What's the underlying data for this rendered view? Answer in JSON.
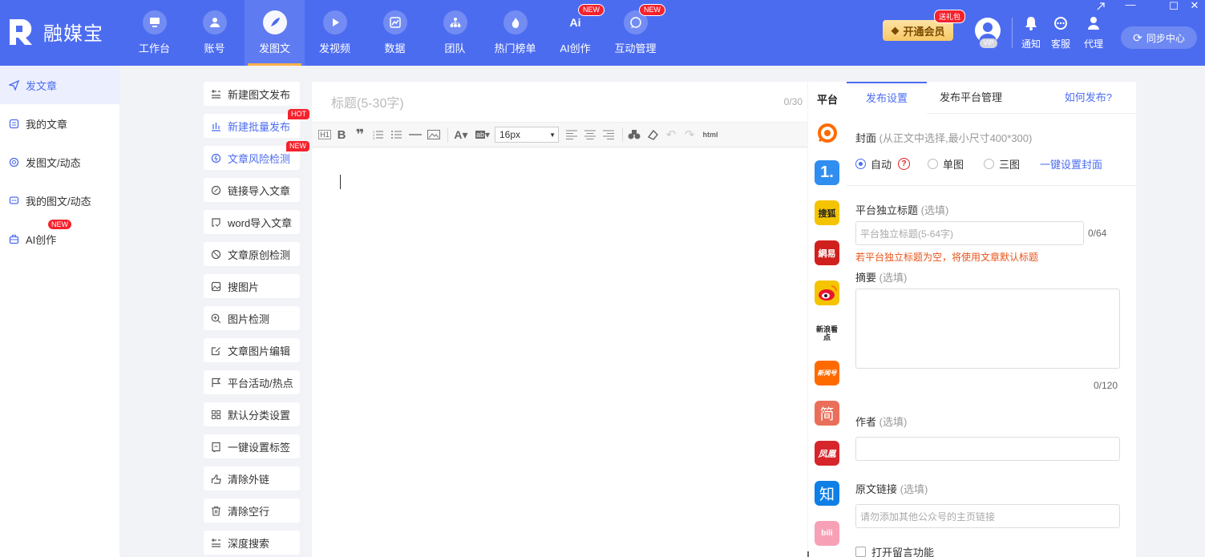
{
  "app": {
    "name": "融媒宝"
  },
  "nav": [
    {
      "label": "工作台",
      "icon": "monitor-icon"
    },
    {
      "label": "账号",
      "icon": "user-icon"
    },
    {
      "label": "发图文",
      "icon": "feather-icon",
      "active": true
    },
    {
      "label": "发视频",
      "icon": "play-icon"
    },
    {
      "label": "数据",
      "icon": "chart-icon"
    },
    {
      "label": "团队",
      "icon": "org-icon"
    },
    {
      "label": "热门榜单",
      "icon": "flame-icon"
    },
    {
      "label": "AI创作",
      "icon": "ai-icon",
      "badge": "NEW"
    },
    {
      "label": "互动管理",
      "icon": "chat-icon",
      "badge": "NEW"
    }
  ],
  "header": {
    "vip_label": "开通会员",
    "gift_badge": "送礼包",
    "vip_tag": "VIP",
    "notify_label": "通知",
    "service_label": "客服",
    "agent_label": "代理",
    "sync_label": "同步中心"
  },
  "sidebar": [
    {
      "label": "发文章",
      "icon": "send-icon",
      "active": true
    },
    {
      "label": "我的文章",
      "icon": "document-icon"
    },
    {
      "label": "发图文/动态",
      "icon": "target-icon"
    },
    {
      "label": "我的图文/动态",
      "icon": "message-icon"
    },
    {
      "label": "AI创作",
      "icon": "briefcase-icon",
      "badge": "NEW"
    }
  ],
  "tools": [
    {
      "label": "新建图文发布",
      "icon": "new-post-icon"
    },
    {
      "label": "新建批量发布",
      "icon": "batch-icon",
      "badge": "HOT",
      "highlight": true
    },
    {
      "label": "文章风险检测",
      "icon": "risk-icon",
      "badge": "NEW",
      "highlight": true
    },
    {
      "label": "链接导入文章",
      "icon": "link-icon"
    },
    {
      "label": "word导入文章",
      "icon": "word-icon"
    },
    {
      "label": "文章原创检测",
      "icon": "original-icon"
    },
    {
      "label": "搜图片",
      "icon": "image-icon"
    },
    {
      "label": "图片检测",
      "icon": "zoom-icon"
    },
    {
      "label": "文章图片编辑",
      "icon": "edit-icon"
    },
    {
      "label": "平台活动/热点",
      "icon": "flag-icon"
    },
    {
      "label": "默认分类设置",
      "icon": "grid-icon"
    },
    {
      "label": "一键设置标签",
      "icon": "tag-icon"
    },
    {
      "label": "清除外链",
      "icon": "unlink-icon"
    },
    {
      "label": "清除空行",
      "icon": "trash-icon"
    },
    {
      "label": "深度搜索",
      "icon": "search-icon"
    }
  ],
  "editor": {
    "title_placeholder": "标题(5-30字)",
    "title_count": "0/30",
    "font_size": "16px",
    "html_label": "html"
  },
  "platforms": {
    "header": "平台",
    "items": [
      {
        "name": "baijiahao",
        "glyph": "",
        "color": "#ffffff"
      },
      {
        "name": "yidian",
        "glyph": "1.",
        "color": "#2f8ef0"
      },
      {
        "name": "sohu",
        "glyph": "搜狐",
        "color": "#f5c400"
      },
      {
        "name": "netease",
        "glyph": "網易",
        "color": "#d0201e"
      },
      {
        "name": "weibo",
        "glyph": "",
        "color": "#f5c400"
      },
      {
        "name": "sina-kandian",
        "glyph": "新浪看点",
        "color": "#ffffff"
      },
      {
        "name": "xinwenquan",
        "glyph": "新闻号",
        "color": "#ff6a00"
      },
      {
        "name": "jianshu",
        "glyph": "简",
        "color": "#ea6f5a"
      },
      {
        "name": "fenghuang",
        "glyph": "凤凰",
        "color": "#d7252c"
      },
      {
        "name": "zhihu",
        "glyph": "知",
        "color": "#0e7fe6"
      },
      {
        "name": "bilibili",
        "glyph": "bili",
        "color": "#f7a0b6"
      }
    ]
  },
  "panel": {
    "tab_settings": "发布设置",
    "tab_platforms": "发布平台管理",
    "how_to": "如何发布?",
    "cover_label": "封面",
    "cover_hint": "(从正文中选择,最小尺寸400*300)",
    "radio_auto": "自动",
    "radio_single": "单图",
    "radio_triple": "三图",
    "one_click_cover": "一键设置封面",
    "title_label": "平台独立标题",
    "optional": "(选填)",
    "title_placeholder": "平台独立标题(5-64字)",
    "title_count": "0/64",
    "title_warning": "若平台独立标题为空，将使用文章默认标题",
    "summary_label": "摘要",
    "summary_count": "0/120",
    "author_label": "作者",
    "source_label": "原文链接",
    "source_placeholder": "请勿添加其他公众号的主页链接",
    "comment_label": "打开留言功能"
  },
  "colors": {
    "primary": "#4c6cf0",
    "accent": "#f5222d",
    "warning": "#e8541b"
  }
}
